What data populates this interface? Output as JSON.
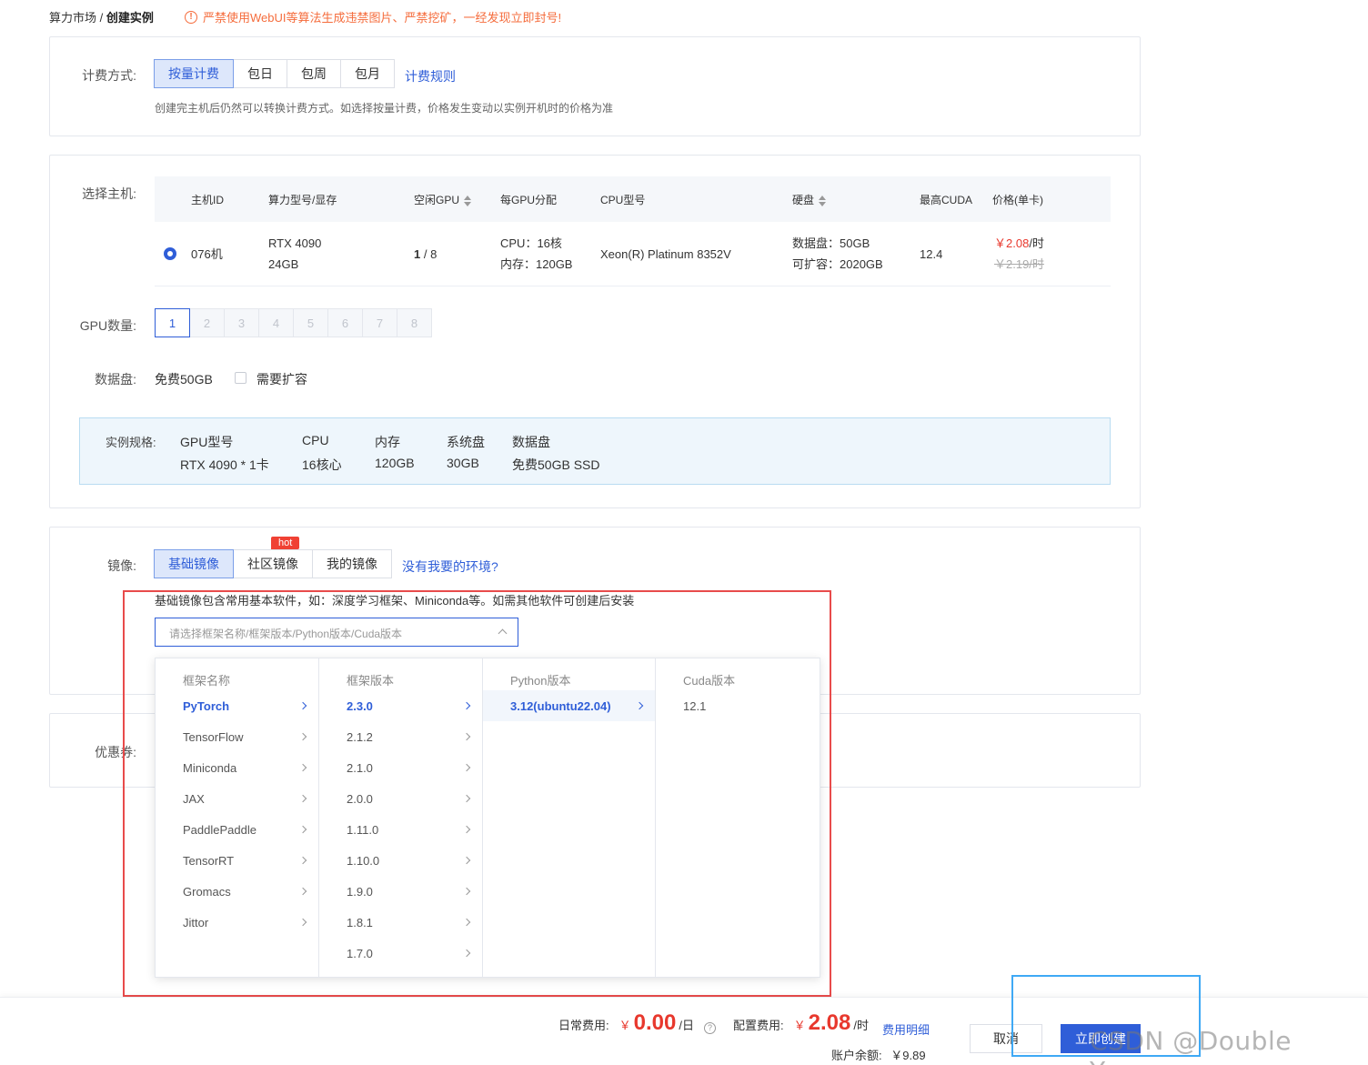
{
  "breadcrumb": {
    "parent": "算力市场",
    "separator": "/",
    "current": "创建实例"
  },
  "warning": {
    "icon": "exclamation-icon",
    "text": "严禁使用WebUI等算法生成违禁图片、严禁挖矿，一经发现立即封号!"
  },
  "billing": {
    "label": "计费方式:",
    "options": [
      "按量计费",
      "包日",
      "包周",
      "包月"
    ],
    "selected": "按量计费",
    "rules_link": "计费规则",
    "hint": "创建完主机后仍然可以转换计费方式。如选择按量计费，价格发生变动以实例开机时的价格为准"
  },
  "host": {
    "label": "选择主机:",
    "columns": [
      "主机ID",
      "算力型号/显存",
      "空闲GPU",
      "每GPU分配",
      "CPU型号",
      "硬盘",
      "最高CUDA",
      "价格(单卡)"
    ],
    "row": {
      "id": "076机",
      "gpu_model": "RTX 4090",
      "vram": "24GB",
      "free_gpu_avail": "1",
      "free_gpu_total": " / 8",
      "cpu_alloc": "CPU：16核",
      "mem_alloc": "内存：120GB",
      "cpu_model": "Xeon(R) Platinum 8352V",
      "disk_data": "数据盘：50GB",
      "disk_expand": "可扩容：2020GB",
      "cuda": "12.4",
      "price_now": "￥2.08",
      "price_unit": "/时",
      "price_old": "￥2.19/时"
    }
  },
  "gpu_count": {
    "label": "GPU数量:",
    "options": [
      "1",
      "2",
      "3",
      "4",
      "5",
      "6",
      "7",
      "8"
    ],
    "selected": "1"
  },
  "data_disk": {
    "label": "数据盘:",
    "free": "免费50GB",
    "expand_label": "需要扩容",
    "expand_checked": false
  },
  "spec": {
    "label": "实例规格:",
    "cols": [
      {
        "h": "GPU型号",
        "v": "RTX 4090 * 1卡"
      },
      {
        "h": "CPU",
        "v": "16核心"
      },
      {
        "h": "内存",
        "v": "120GB"
      },
      {
        "h": "系统盘",
        "v": "30GB"
      },
      {
        "h": "数据盘",
        "v": "免费50GB SSD"
      }
    ]
  },
  "image": {
    "label": "镜像:",
    "tabs": [
      "基础镜像",
      "社区镜像",
      "我的镜像"
    ],
    "selected": "基础镜像",
    "hot_badge": "hot",
    "help_link": "没有我要的环境?",
    "hint": "基础镜像包含常用基本软件，如：深度学习框架、Miniconda等。如需其他软件可创建后安装",
    "placeholder": "请选择框架名称/框架版本/Python版本/Cuda版本"
  },
  "cascader": {
    "framework": {
      "title": "框架名称",
      "items": [
        "PyTorch",
        "TensorFlow",
        "Miniconda",
        "JAX",
        "PaddlePaddle",
        "TensorRT",
        "Gromacs",
        "Jittor"
      ],
      "selected": "PyTorch"
    },
    "version": {
      "title": "框架版本",
      "items": [
        "2.3.0",
        "2.1.2",
        "2.1.0",
        "2.0.0",
        "1.11.0",
        "1.10.0",
        "1.9.0",
        "1.8.1",
        "1.7.0"
      ],
      "selected": "2.3.0"
    },
    "python": {
      "title": "Python版本",
      "items": [
        "3.12(ubuntu22.04)"
      ],
      "selected": "3.12(ubuntu22.04)"
    },
    "cuda": {
      "title": "Cuda版本",
      "items": [
        "12.1"
      ]
    }
  },
  "coupon": {
    "label": "优惠券:"
  },
  "footer": {
    "daily_label": "日常费用:",
    "daily_currency": "￥",
    "daily_value": "0.00",
    "daily_unit": "/日",
    "help_icon": "question-icon",
    "config_label": "配置费用:",
    "config_currency": "￥",
    "config_value": "2.08",
    "config_unit": "/时",
    "detail_link": "费用明细",
    "balance_label": "账户余额:",
    "balance_value": "￥9.89",
    "cancel": "取消",
    "create": "立即创建"
  },
  "watermark": "CSDN @Double Young.",
  "colors": {
    "primary": "#2f5ed8",
    "danger": "#e8382d",
    "warning": "#f56c3c",
    "annotation_red": "#e84b4b",
    "annotation_blue": "#3fa9f5"
  }
}
